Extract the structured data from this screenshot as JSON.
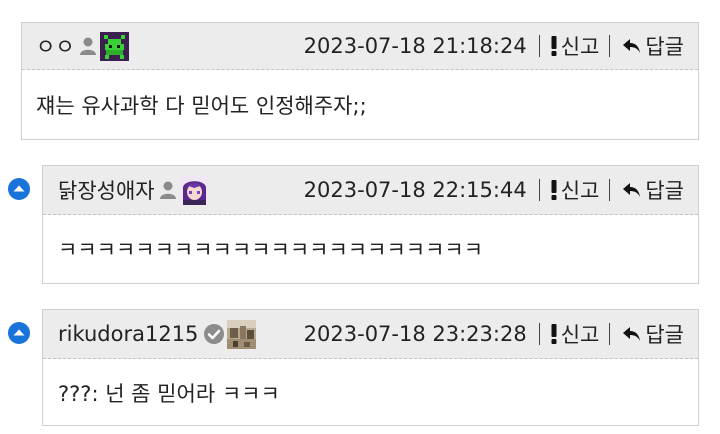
{
  "comments": [
    {
      "nickname": "ㅇㅇ",
      "timestamp": "2023-07-18 21:18:24",
      "report_label": "신고",
      "reply_label": "답글",
      "text": "쟤는 유사과학 다 믿어도 인정해주자;;"
    },
    {
      "nickname": "닭장성애자",
      "timestamp": "2023-07-18 22:15:44",
      "report_label": "신고",
      "reply_label": "답글",
      "text": "ㅋㅋㅋㅋㅋㅋㅋㅋㅋㅋㅋㅋㅋㅋㅋㅋㅋㅋㅋㅋㅋㅋ"
    },
    {
      "nickname": "rikudora1215",
      "timestamp": "2023-07-18 23:23:28",
      "report_label": "신고",
      "reply_label": "답글",
      "text": "???: 넌 좀 믿어라 ㅋㅋㅋ"
    }
  ],
  "colors": {
    "reply_marker": "#1a73d9",
    "header_bg": "#ececec",
    "border": "#cfcfcf"
  },
  "icons": {
    "person": "person-icon",
    "verified": "verified-check-icon",
    "report": "exclamation-icon",
    "reply": "reply-arrow-icon",
    "reply_marker": "up-arrow-circle-icon"
  }
}
